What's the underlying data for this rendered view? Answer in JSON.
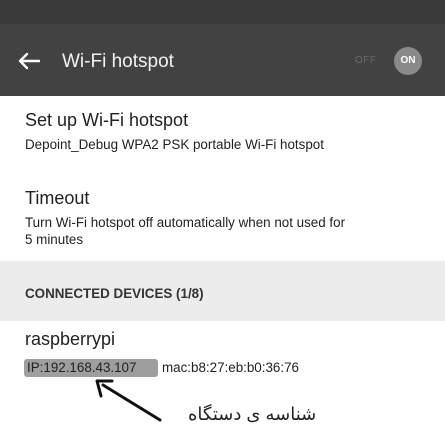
{
  "toolbar": {
    "title": "Wi-Fi hotspot",
    "switch_off_label": "OFF",
    "switch_on_label": "ON"
  },
  "prefs": [
    {
      "title": "Set up Wi-Fi hotspot",
      "summary": "Depoint_Debug WPA2 PSK portable Wi-Fi hotspot"
    },
    {
      "title": "Timeout",
      "summary_line1": "Turn Wi-Fi hotspot off automatically when not used for",
      "summary_line2": "5 minutes"
    }
  ],
  "connected": {
    "header": "CONNECTED DEVICES (1/8)",
    "devices": [
      {
        "name": "raspberrypi",
        "ip": "IP:192.168.43.107",
        "mac": "mac:b8:27:eb:b0:36:76"
      }
    ]
  },
  "annotation": {
    "text": "شناسه ی دستگاه"
  },
  "colors": {
    "toolbar": "#424242",
    "category_bg": "#ececec",
    "ip_highlight": "#9e9e9e"
  }
}
